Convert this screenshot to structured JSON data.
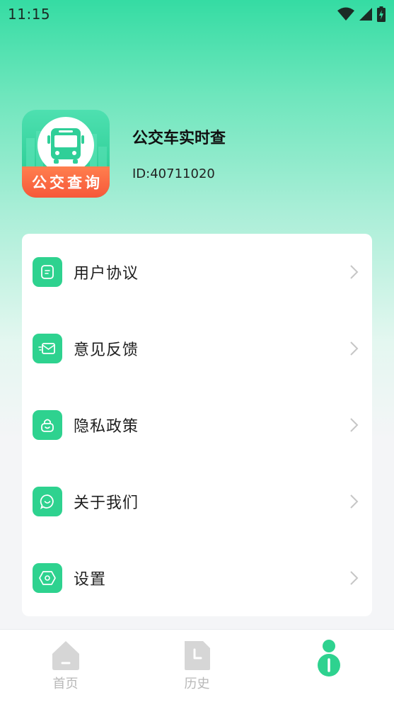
{
  "status_bar": {
    "time": "11:15"
  },
  "profile": {
    "logo_text": "公交查询",
    "app_name": "公交车实时查",
    "user_id": "ID:40711020"
  },
  "menu": {
    "items": [
      {
        "label": "用户协议",
        "icon": "document-icon"
      },
      {
        "label": "意见反馈",
        "icon": "mail-icon"
      },
      {
        "label": "隐私政策",
        "icon": "lock-icon"
      },
      {
        "label": "关于我们",
        "icon": "chat-smile-icon"
      },
      {
        "label": "设置",
        "icon": "settings-icon"
      }
    ]
  },
  "tab_bar": {
    "tabs": [
      {
        "label": "首页",
        "icon": "home-icon",
        "active": false
      },
      {
        "label": "历史",
        "icon": "history-icon",
        "active": false
      },
      {
        "label": "",
        "icon": "user-icon",
        "active": true
      }
    ]
  },
  "colors": {
    "accent": "#2ed28f",
    "gradient_top": "#35dca3",
    "logo_banner": "#f6583a",
    "inactive_tab": "#d3d3d3"
  }
}
